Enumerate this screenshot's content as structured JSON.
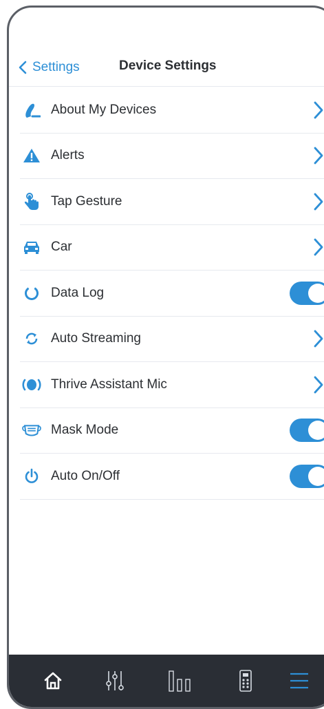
{
  "header": {
    "back_label": "Settings",
    "title": "Device Settings"
  },
  "items": [
    {
      "label": "About My Devices",
      "icon": "ear-icon",
      "control": "chevron"
    },
    {
      "label": "Alerts",
      "icon": "warning-icon",
      "control": "chevron"
    },
    {
      "label": "Tap Gesture",
      "icon": "tap-hand-icon",
      "control": "chevron"
    },
    {
      "label": "Car",
      "icon": "car-icon",
      "control": "chevron"
    },
    {
      "label": "Data Log",
      "icon": "data-log-ring-icon",
      "control": "toggle",
      "on": true
    },
    {
      "label": "Auto Streaming",
      "icon": "sync-arrows-icon",
      "control": "chevron"
    },
    {
      "label": "Thrive Assistant Mic",
      "icon": "microphone-waves-icon",
      "control": "chevron"
    },
    {
      "label": "Mask Mode",
      "icon": "face-mask-icon",
      "control": "toggle",
      "on": true
    },
    {
      "label": "Auto On/Off",
      "icon": "power-icon",
      "control": "toggle",
      "on": true
    }
  ],
  "tabbar": {
    "tabs": [
      "home-icon",
      "sliders-icon",
      "bar-chart-icon",
      "remote-icon",
      "menu-icon"
    ],
    "active": "menu-icon"
  },
  "colors": {
    "accent": "#2d8fd6",
    "tabbar_bg": "#2a2e35",
    "text": "#2c2f33"
  }
}
